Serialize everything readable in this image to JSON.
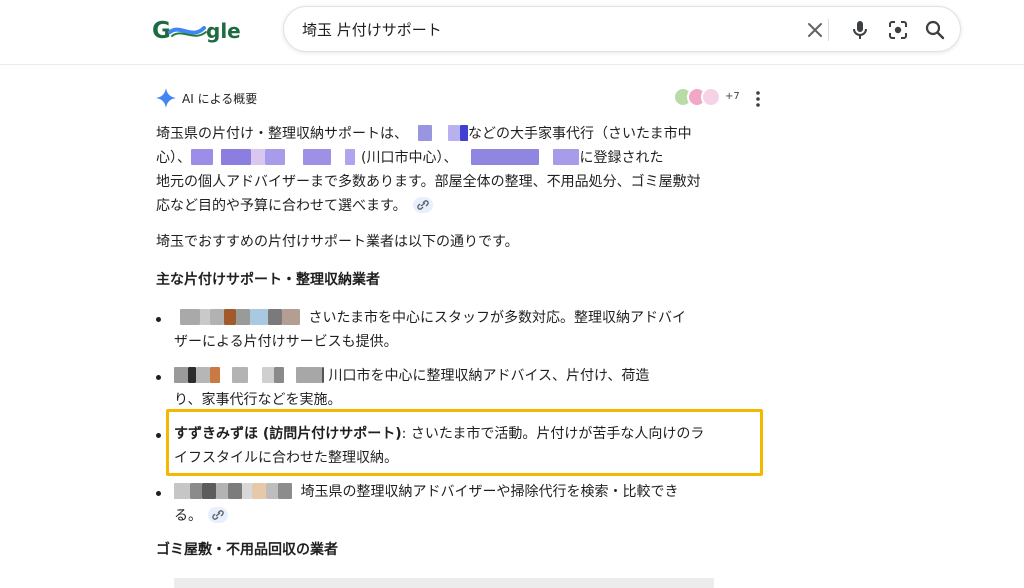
{
  "search": {
    "query": "埼玉 片付けサポート"
  },
  "icons": {
    "clear": "close-icon",
    "voice": "microphone-icon",
    "lens": "camera-lens-icon",
    "search": "search-icon",
    "ai": "sparkle-icon",
    "more": "more-vertical-icon",
    "link": "link-icon"
  },
  "ai_overview": {
    "title": "AI による概要",
    "sources_count": "+7",
    "intro": {
      "l1_a": "埼玉県の片付け・整理収納サポートは、",
      "l1_b": "などの大手家事代行（さいたま市中",
      "l2_a": "心）、",
      "l2_b": "(川口市中心）、",
      "l2_c": "に登録された",
      "l3": "地元の個人アドバイザーまで多数あります。部屋全体の整理、不用品処分、ゴミ屋敷対",
      "l4": "応など目的や予算に合わせて選べます。"
    },
    "recommend": "埼玉でおすすめの片付けサポート業者は以下の通りです。",
    "section1_heading": "主な片付けサポート・整理収納業者",
    "bullets": {
      "b1_l1": "さいたま市を中心にスタッフが多数対応。整理収納アドバイ",
      "b1_l2": "ザーによる片付けサービスも提供。",
      "b2_l1": "川口市を中心に整理収納アドバイス、片付け、荷造",
      "b2_l2": "り、家事代行などを実施。",
      "b3_name": "すずきみずほ (訪問片付けサポート)",
      "b3_l1_rest": ": さいたま市で活動。片付けが苦手な人向けのラ",
      "b3_l2": "イフスタイルに合わせた整理収納。",
      "b4_l1": "埼玉県の整理収納アドバイザーや掃除代行を検索・比較でき",
      "b4_l2": "る。"
    },
    "section2_heading": "ゴミ屋敷・不用品回収の業者"
  },
  "colors": {
    "highlight": "#f5b800",
    "link_chip": "#e8f0fe",
    "logo_blue": "#4285f4",
    "logo_green": "#1e7f3c"
  }
}
